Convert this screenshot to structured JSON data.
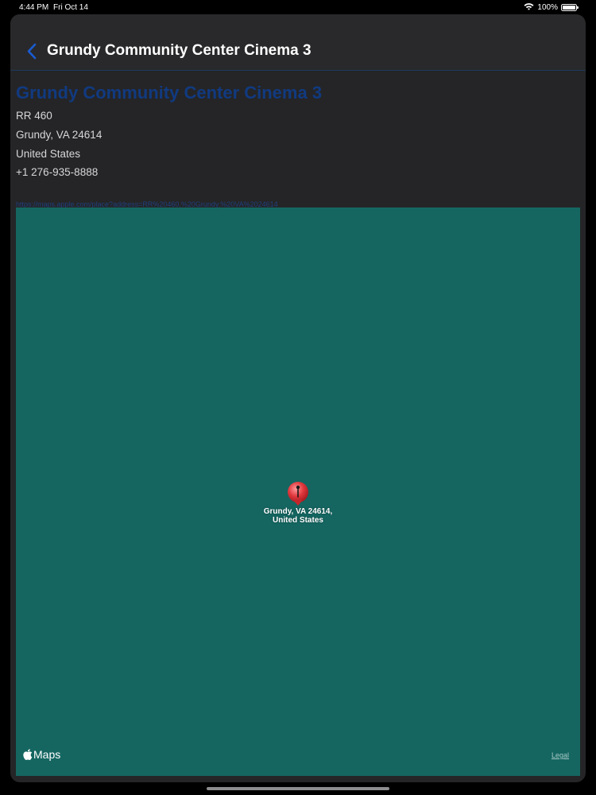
{
  "status_bar": {
    "time": "4:44 PM",
    "date": "Fri Oct 14",
    "battery": "100%",
    "battery_level": 1.0
  },
  "nav": {
    "title": "Grundy Community Center Cinema 3"
  },
  "detail": {
    "title": "Grundy Community Center Cinema 3",
    "address_line1": "RR 460",
    "address_line2": "Grundy, VA 24614",
    "country": "United States",
    "phone": "+1 276-935-8888",
    "link": "https://maps.apple.com/place?address=RR%20460,%20Grundy,%20VA%2024614"
  },
  "map": {
    "pin_label_line1": "Grundy, VA  24614,",
    "pin_label_line2": "United States",
    "brand": "Maps",
    "legal": "Legal",
    "background_color": "#156661",
    "pin_color": "#e0383d"
  }
}
